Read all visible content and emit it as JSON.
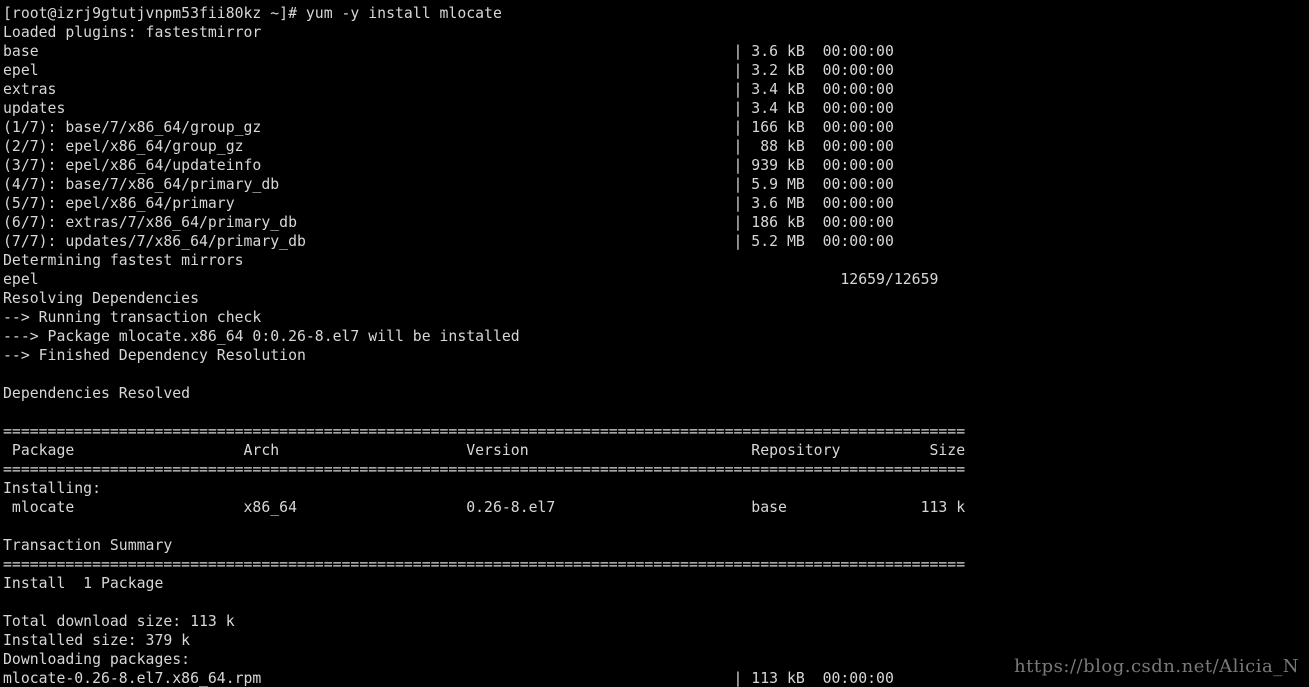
{
  "terminal": {
    "lines": [
      "[root@izrj9gtutjvnpm53fii80kz ~]# yum -y install mlocate",
      "Loaded plugins: fastestmirror",
      "base                                                                              | 3.6 kB  00:00:00",
      "epel                                                                              | 3.2 kB  00:00:00",
      "extras                                                                            | 3.4 kB  00:00:00",
      "updates                                                                           | 3.4 kB  00:00:00",
      "(1/7): base/7/x86_64/group_gz                                                     | 166 kB  00:00:00",
      "(2/7): epel/x86_64/group_gz                                                       |  88 kB  00:00:00",
      "(3/7): epel/x86_64/updateinfo                                                     | 939 kB  00:00:00",
      "(4/7): base/7/x86_64/primary_db                                                   | 5.9 MB  00:00:00",
      "(5/7): epel/x86_64/primary                                                        | 3.6 MB  00:00:00",
      "(6/7): extras/7/x86_64/primary_db                                                 | 186 kB  00:00:00",
      "(7/7): updates/7/x86_64/primary_db                                                | 5.2 MB  00:00:00",
      "Determining fastest mirrors",
      "epel                                                                                          12659/12659",
      "Resolving Dependencies",
      "--> Running transaction check",
      "---> Package mlocate.x86_64 0:0.26-8.el7 will be installed",
      "--> Finished Dependency Resolution",
      "",
      "Dependencies Resolved",
      "",
      "============================================================================================================",
      " Package                   Arch                     Version                         Repository          Size",
      "============================================================================================================",
      "Installing:",
      " mlocate                   x86_64                   0.26-8.el7                      base               113 k",
      "",
      "Transaction Summary",
      "============================================================================================================",
      "Install  1 Package",
      "",
      "Total download size: 113 k",
      "Installed size: 379 k",
      "Downloading packages:",
      "mlocate-0.26-8.el7.x86_64.rpm                                                     | 113 kB  00:00:00"
    ]
  },
  "watermark": "https://blog.csdn.net/Alicia_N"
}
